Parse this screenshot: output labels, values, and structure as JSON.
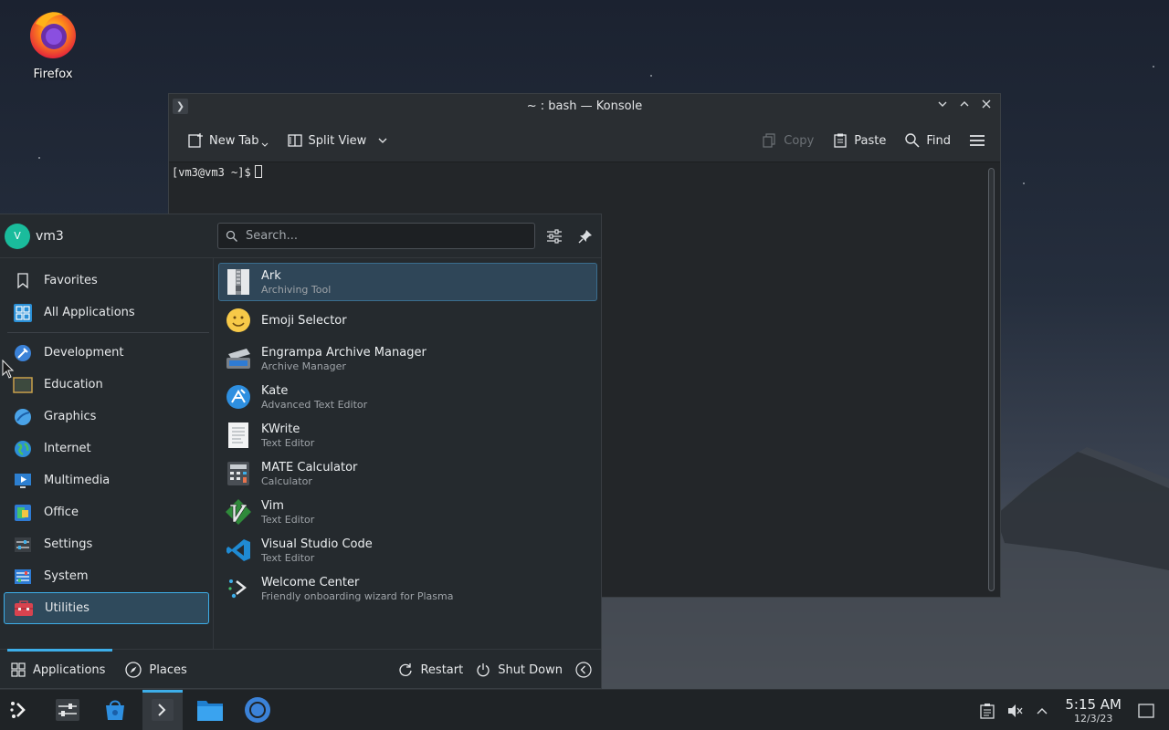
{
  "desktop": {
    "icons": [
      {
        "label": "Firefox",
        "icon": "firefox-icon"
      }
    ]
  },
  "konsole": {
    "title": "~ : bash — Konsole",
    "toolbar": {
      "new_tab": "New Tab",
      "split_view": "Split View",
      "copy": "Copy",
      "paste": "Paste",
      "find": "Find"
    },
    "prompt": "[vm3@vm3 ~]$"
  },
  "launcher": {
    "user": {
      "initial": "V",
      "name": "vm3"
    },
    "search_placeholder": "Search...",
    "categories": [
      {
        "label": "Favorites",
        "icon": "bookmark-icon"
      },
      {
        "label": "All Applications",
        "icon": "grid-icon"
      },
      {
        "label": "Development",
        "icon": "development-icon"
      },
      {
        "label": "Education",
        "icon": "education-icon"
      },
      {
        "label": "Graphics",
        "icon": "graphics-icon"
      },
      {
        "label": "Internet",
        "icon": "globe-icon"
      },
      {
        "label": "Multimedia",
        "icon": "multimedia-icon"
      },
      {
        "label": "Office",
        "icon": "office-icon"
      },
      {
        "label": "Settings",
        "icon": "settings-icon"
      },
      {
        "label": "System",
        "icon": "system-icon"
      },
      {
        "label": "Utilities",
        "icon": "utilities-icon"
      }
    ],
    "active_category": "Utilities",
    "apps": [
      {
        "name": "Ark",
        "desc": "Archiving Tool",
        "icon": "ark-icon"
      },
      {
        "name": "Emoji Selector",
        "desc": "",
        "icon": "emoji-icon"
      },
      {
        "name": "Engrampa Archive Manager",
        "desc": "Archive Manager",
        "icon": "engrampa-icon"
      },
      {
        "name": "Kate",
        "desc": "Advanced Text Editor",
        "icon": "kate-icon"
      },
      {
        "name": "KWrite",
        "desc": "Text Editor",
        "icon": "kwrite-icon"
      },
      {
        "name": "MATE Calculator",
        "desc": "Calculator",
        "icon": "calculator-icon"
      },
      {
        "name": "Vim",
        "desc": "Text Editor",
        "icon": "vim-icon"
      },
      {
        "name": "Visual Studio Code",
        "desc": "Text Editor",
        "icon": "vscode-icon"
      },
      {
        "name": "Welcome Center",
        "desc": "Friendly onboarding wizard for Plasma",
        "icon": "welcome-icon"
      }
    ],
    "footer": {
      "applications": "Applications",
      "places": "Places",
      "restart": "Restart",
      "shutdown": "Shut Down"
    }
  },
  "taskbar": {
    "time": "5:15 AM",
    "date": "12/3/23"
  },
  "colors": {
    "accent": "#3daee9",
    "panel": "#252a2e",
    "taskbar": "#1f2326"
  }
}
